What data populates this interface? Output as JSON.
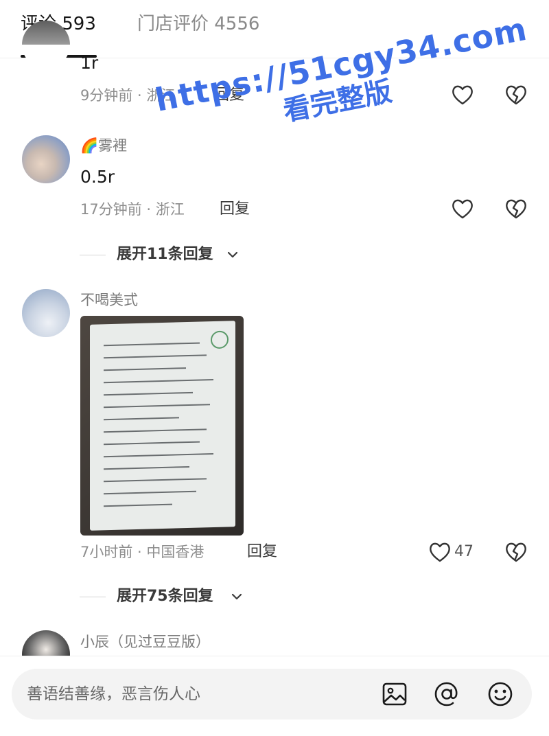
{
  "tabs": [
    {
      "label": "评论 593"
    },
    {
      "label": "门店评价 4556"
    }
  ],
  "comments": [
    {
      "content": "1r",
      "time_location": "9分钟前 · 浙江",
      "reply_label": "回复"
    },
    {
      "name": "🌈雾裡",
      "content": "0.5r",
      "time_location": "17分钟前 · 浙江",
      "reply_label": "回复",
      "expand_label": "展开11条回复"
    },
    {
      "name": "不喝美式",
      "time_location": "7小时前 · 中国香港",
      "reply_label": "回复",
      "like_count": "47",
      "expand_label": "展开75条回复"
    },
    {
      "name": "小辰（见过豆豆版）"
    }
  ],
  "watermark": {
    "url": "https://51cgy34.com",
    "subtitle": "看完整版"
  },
  "composer": {
    "placeholder": "善语结善缘，恶言伤人心"
  },
  "icons": [
    "heart-icon",
    "broken-heart-icon",
    "chevron-down-icon",
    "image-icon",
    "at-icon",
    "emoji-icon"
  ],
  "colors": {
    "watermark": "#3e6fe6",
    "text": "#161616",
    "muted": "#8e8e8e"
  }
}
